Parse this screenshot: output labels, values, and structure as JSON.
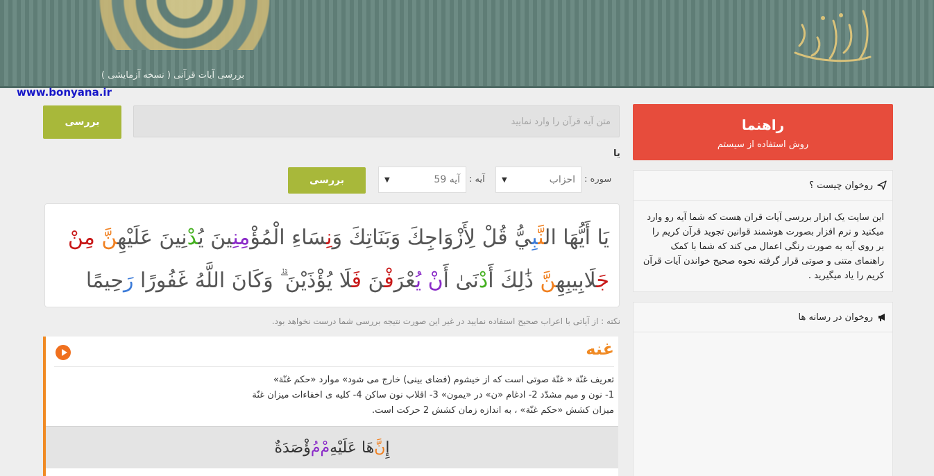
{
  "header": {
    "subtitle": "بررسی آیات قرآنی ( نسخه آزمایشی )",
    "logo_text": "روخوان"
  },
  "watermark_url": "www.bonyana.ir",
  "search": {
    "placeholder": "متن آیه قرآن را وارد نمایید",
    "submit_label": "بررسی",
    "or_label": "یا"
  },
  "selector": {
    "surah_label": "سوره :",
    "surah_value": "احزاب",
    "ayah_label": ": آیه",
    "ayah_value": "آیه 59",
    "submit_label": "بررسی"
  },
  "verse": {
    "segments": [
      {
        "t": "يَا أَيُّهَا ال",
        "c": ""
      },
      {
        "t": "نَّ",
        "c": "c-orange"
      },
      {
        "t": "بِ",
        "c": "c-blue"
      },
      {
        "t": "يُّ قُلْ لِأَزْوَاجِكَ وَبَنَاتِكَ وَ",
        "c": ""
      },
      {
        "t": "نِ",
        "c": "c-red"
      },
      {
        "t": "سَاءِ الْمُؤْ",
        "c": ""
      },
      {
        "t": "مِنِ",
        "c": "c-purple"
      },
      {
        "t": "ينَ يُ",
        "c": ""
      },
      {
        "t": "دْ",
        "c": "c-green"
      },
      {
        "t": "نِينَ عَلَيْهِ",
        "c": ""
      },
      {
        "t": "نَّ",
        "c": "c-orange"
      },
      {
        "t": " ",
        "c": ""
      },
      {
        "t": "مِنْ",
        "c": "c-red"
      },
      {
        "t": " ",
        "c": ""
      },
      {
        "t": "جَ",
        "c": "c-red"
      },
      {
        "t": "لَابِيبِهِ",
        "c": ""
      },
      {
        "t": "نَّ",
        "c": "c-orange"
      },
      {
        "t": " ذَٰلِكَ أَ",
        "c": ""
      },
      {
        "t": "دْ",
        "c": "c-green"
      },
      {
        "t": "نَىٰ أَ",
        "c": ""
      },
      {
        "t": "نْ يُ",
        "c": "c-purple"
      },
      {
        "t": "عْرَ",
        "c": ""
      },
      {
        "t": "فْ",
        "c": "c-red"
      },
      {
        "t": "نَ ",
        "c": ""
      },
      {
        "t": "فَ",
        "c": "c-red"
      },
      {
        "t": "لَا يُؤْذَيْنَ ۗ وَكَانَ اللَّهُ غَفُورًا ",
        "c": ""
      },
      {
        "t": "رَ",
        "c": "c-blue"
      },
      {
        "t": "حِيمًا",
        "c": ""
      }
    ]
  },
  "note": "نکته : از آیاتی با اعراب صحیح استفاده نمایید در غیر این صورت نتیجه بررسی شما درست نخواهد بود.",
  "rule": {
    "title": "غنه",
    "lines": [
      "تعریف غنّة « غنّة صوتی است که از خیشوم (فضای بینی) خارج می شود» موارد «حکم غنّة»",
      "1- نون و میم مشدّد 2- ادغام «ن» در «یمون» 3- اقلاب نون ساکن 4- کلیه ی اخفاءات میزان غنّة",
      "میزان کشش «حکم غنّة» ، به اندازه زمان کشش 2 حرکت است."
    ],
    "example_segments": [
      {
        "t": "إِ",
        "c": ""
      },
      {
        "t": "نَّ",
        "c": "c-orange"
      },
      {
        "t": "هَا عَلَيْهِ",
        "c": ""
      },
      {
        "t": "مْ",
        "c": "c-purple"
      },
      {
        "t": " ",
        "c": ""
      },
      {
        "t": "مُ",
        "c": "c-purple"
      },
      {
        "t": "ؤْصَدَةٌ",
        "c": ""
      }
    ]
  },
  "sidebar": {
    "guide_title": "راهنما",
    "guide_subtitle": "روش استفاده از سیستم",
    "about_title": "روخوان چیست ؟",
    "about_body": "این سایت یک ابزار بررسی آیات قران هست که شما آیه رو وارد میکنید و نرم افزار بصورت هوشمند قوانین تجوید قرآن کریم را بر روی آیه به صورت رنگی اعمال می کند که شما با کمک راهنمای متنی و صوتی قرار گرفته نحوه صحیح خواندن آیات قرآن کریم را یاد میگیرید .",
    "media_title": "روخوان در رسانه ها"
  }
}
